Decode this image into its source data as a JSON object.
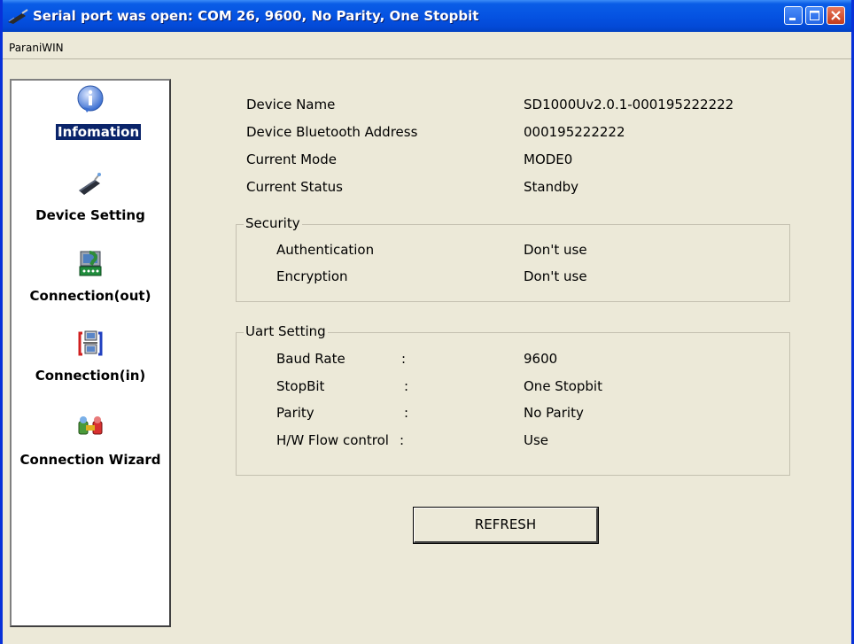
{
  "window": {
    "title": "Serial port was open: COM 26, 9600, No Parity, One Stopbit"
  },
  "menubar": {
    "items": [
      "ParaniWIN"
    ]
  },
  "sidebar": {
    "items": [
      {
        "label": "Infomation",
        "icon": "information-icon",
        "selected": true
      },
      {
        "label": "Device Setting",
        "icon": "device-icon",
        "selected": false
      },
      {
        "label": "Connection(out)",
        "icon": "connection-out-icon",
        "selected": false
      },
      {
        "label": "Connection(in)",
        "icon": "connection-in-icon",
        "selected": false
      },
      {
        "label": "Connection Wizard",
        "icon": "wizard-icon",
        "selected": false
      }
    ]
  },
  "info": {
    "device_name": {
      "label": "Device Name",
      "value": "SD1000Uv2.0.1-000195222222"
    },
    "bt_address": {
      "label": "Device Bluetooth Address",
      "value": "000195222222"
    },
    "mode": {
      "label": "Current Mode",
      "value": "MODE0"
    },
    "status": {
      "label": "Current Status",
      "value": "Standby"
    }
  },
  "security": {
    "title": "Security",
    "authentication": {
      "label": "Authentication",
      "value": "Don't use"
    },
    "encryption": {
      "label": "Encryption",
      "value": "Don't use"
    }
  },
  "uart": {
    "title": "Uart Setting",
    "rows": [
      {
        "label": "Baud Rate",
        "sep": ":",
        "value": "9600"
      },
      {
        "label": "StopBit",
        "sep": ":",
        "value": "One Stopbit"
      },
      {
        "label": "Parity",
        "sep": ":",
        "value": "No Parity"
      },
      {
        "label": "H/W Flow control",
        "sep": ":",
        "value": "Use"
      }
    ]
  },
  "refresh_label": "REFRESH",
  "colors": {
    "titlebar": "#0553e2",
    "selection": "#0a246a",
    "background": "#ece9d8"
  }
}
